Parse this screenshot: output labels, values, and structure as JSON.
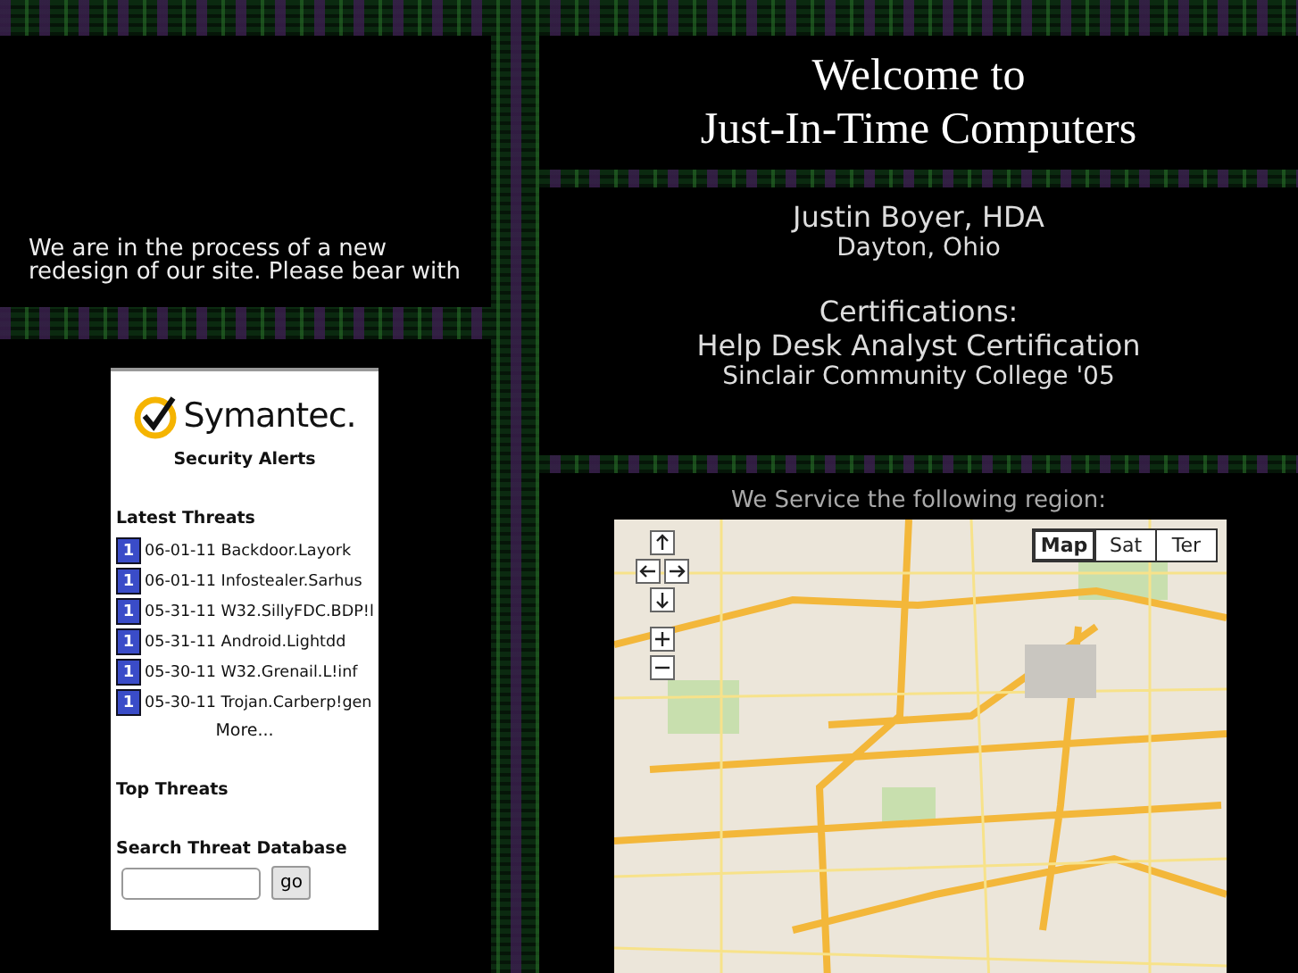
{
  "notice": {
    "lines": [
      "We are in the process of a new",
      "redesign of our site. Please bear with"
    ]
  },
  "widget": {
    "logo_text": "Symantec.",
    "title": "Security Alerts",
    "latest_heading": "Latest Threats",
    "threats": [
      {
        "badge": "1",
        "text": "06-01-11 Backdoor.Layork"
      },
      {
        "badge": "1",
        "text": "06-01-11 Infostealer.Sarhus"
      },
      {
        "badge": "1",
        "text": "05-31-11 W32.SillyFDC.BDP!l"
      },
      {
        "badge": "1",
        "text": "05-31-11 Android.Lightdd"
      },
      {
        "badge": "1",
        "text": "05-30-11 W32.Grenail.L!inf"
      },
      {
        "badge": "1",
        "text": "05-30-11 Trojan.Carberp!gen"
      }
    ],
    "more_link": "More...",
    "top_heading": "Top Threats",
    "search_heading": "Search Threat Database",
    "search_button": "go"
  },
  "header": {
    "title_lines": [
      "Welcome to",
      "Just-In-Time Computers"
    ]
  },
  "profile": {
    "name": "Justin Boyer, HDA",
    "location": "Dayton, Ohio",
    "cert_heading": "Certifications:",
    "cert_name": "Help Desk Analyst Certification",
    "cert_school": "Sinclair Community College '05"
  },
  "region": {
    "caption": "We Service the following region:",
    "map_types": [
      {
        "label": "Map",
        "selected": true
      },
      {
        "label": "Sat",
        "selected": false
      },
      {
        "label": "Ter",
        "selected": false
      }
    ]
  }
}
